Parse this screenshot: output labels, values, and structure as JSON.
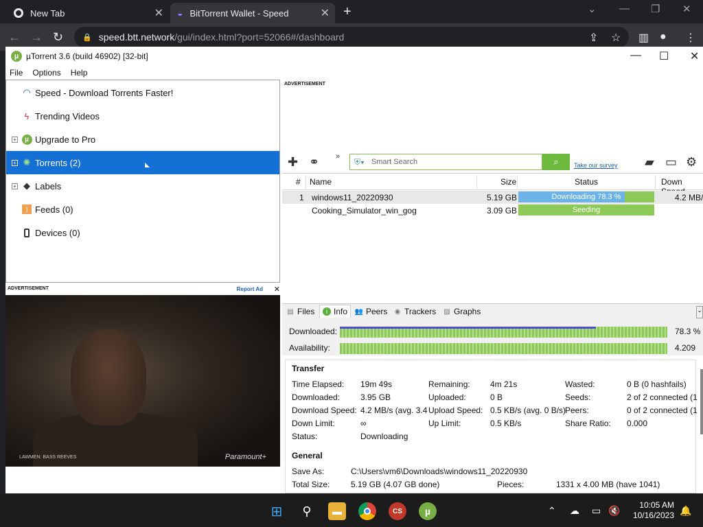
{
  "browser": {
    "tabs": [
      {
        "title": "New Tab",
        "active": false
      },
      {
        "title": "BitTorrent Wallet - Speed",
        "active": true
      }
    ],
    "url_host": "speed.btt.network",
    "url_path": "/gui/index.html?port=52066#/dashboard"
  },
  "window": {
    "title": "µTorrent 3.6  (build 46902) [32-bit]"
  },
  "menu": [
    "File",
    "Options",
    "Help"
  ],
  "sidebar": {
    "items": [
      {
        "label": "Speed - Download Torrents Faster!",
        "icon": "speedometer-icon",
        "expandable": false,
        "selected": false
      },
      {
        "label": "Trending Videos",
        "icon": "lightning-icon",
        "expandable": false,
        "selected": false
      },
      {
        "label": "Upgrade to Pro",
        "icon": "utorrent-logo-icon",
        "expandable": true,
        "selected": false
      },
      {
        "label": "Torrents (2)",
        "icon": "globe-icon",
        "expandable": true,
        "selected": true
      },
      {
        "label": "Labels",
        "icon": "tag-icon",
        "expandable": true,
        "selected": false
      },
      {
        "label": "Feeds (0)",
        "icon": "rss-icon",
        "expandable": false,
        "selected": false
      },
      {
        "label": "Devices (0)",
        "icon": "phone-icon",
        "expandable": false,
        "selected": false
      }
    ]
  },
  "ads": {
    "label": "ADVERTISEMENT",
    "report": "Report Ad",
    "video_caption": "LAWMEN: BASS REEVES",
    "video_brand": "Paramount+"
  },
  "search": {
    "placeholder": "Smart Search",
    "survey_link": "Take our survey"
  },
  "torrent_list": {
    "columns": [
      "#",
      "Name",
      "Size",
      "Status",
      "Down Speed"
    ],
    "rows": [
      {
        "num": "1",
        "name": "windows11_20220930",
        "size": "5.19 GB",
        "status": "Downloading 78.3 %",
        "progress": 0.783,
        "down_speed": "4.2 MB/"
      },
      {
        "num": "",
        "name": "Cooking_Simulator_win_gog",
        "size": "3.09 GB",
        "status": "Seeding",
        "progress": 1.0,
        "down_speed": ""
      }
    ]
  },
  "details": {
    "tabs": [
      "Files",
      "Info",
      "Peers",
      "Trackers",
      "Graphs"
    ],
    "active_tab": "Info",
    "downloaded_label": "Downloaded:",
    "downloaded_value": "78.3 %",
    "availability_label": "Availability:",
    "availability_value": "4.209",
    "transfer_heading": "Transfer",
    "transfer": {
      "time_elapsed_label": "Time Elapsed:",
      "time_elapsed": "19m 49s",
      "remaining_label": "Remaining:",
      "remaining": "4m 21s",
      "wasted_label": "Wasted:",
      "wasted": "0 B (0 hashfails)",
      "downloaded_label": "Downloaded:",
      "downloaded": "3.95 GB",
      "uploaded_label": "Uploaded:",
      "uploaded": "0 B",
      "seeds_label": "Seeds:",
      "seeds": "2 of 2 connected (1",
      "download_speed_label": "Download Speed:",
      "download_speed": "4.2 MB/s (avg. 3.4",
      "upload_speed_label": "Upload Speed:",
      "upload_speed": "0.5 KB/s (avg. 0 B/s)",
      "peers_label": "Peers:",
      "peers": "0 of 2 connected (1",
      "down_limit_label": "Down Limit:",
      "down_limit": "∞",
      "up_limit_label": "Up Limit:",
      "up_limit": "0.5 KB/s",
      "share_ratio_label": "Share Ratio:",
      "share_ratio": "0.000",
      "status_label": "Status:",
      "status": "Downloading"
    },
    "general_heading": "General",
    "general": {
      "save_as_label": "Save As:",
      "save_as": "C:\\Users\\vm6\\Downloads\\windows11_20220930",
      "total_size_label": "Total Size:",
      "total_size": "5.19 GB (4.07 GB done)",
      "pieces_label": "Pieces:",
      "pieces": "1331 x 4.00 MB (have 1041)"
    }
  },
  "taskbar": {
    "time": "10:05 AM",
    "date": "10/16/2023"
  },
  "colors": {
    "selection": "#1570d5",
    "progress_green": "#8dc957",
    "progress_blue": "#6bb3e8",
    "search_green": "#6dba3e"
  }
}
